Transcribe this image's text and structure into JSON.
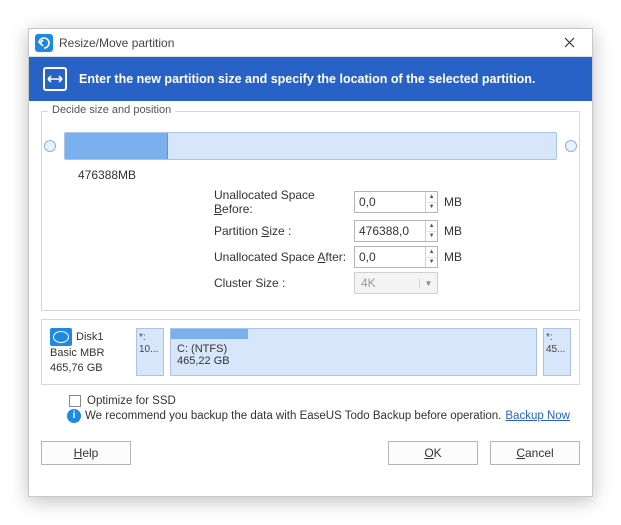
{
  "window": {
    "title": "Resize/Move partition"
  },
  "banner": {
    "text": "Enter the new partition size and specify the location of the selected partition."
  },
  "fieldset": {
    "legend": "Decide size and position",
    "partition_size_text": "476388MB",
    "fill_percent": 21
  },
  "form": {
    "unalloc_before": {
      "label_pre": "Unallocated Space ",
      "accel": "B",
      "label_post": "efore:",
      "value": "0,0",
      "unit": "MB"
    },
    "partition_size": {
      "label_pre": "Partition ",
      "accel": "S",
      "label_post": "ize :",
      "value": "476388,0",
      "unit": "MB"
    },
    "unalloc_after": {
      "label_pre": "Unallocated Space ",
      "accel": "A",
      "label_post": "fter:",
      "value": "0,0",
      "unit": "MB"
    },
    "cluster": {
      "label": "Cluster Size :",
      "value": "4K"
    }
  },
  "disk": {
    "name": "Disk1",
    "type": "Basic MBR",
    "capacity": "465,76 GB",
    "mini_left": {
      "label": "*:",
      "size": "10..."
    },
    "main": {
      "label": "C: (NTFS)",
      "size": "465,22 GB",
      "fill_percent": 21
    },
    "mini_right": {
      "label": "*:",
      "size": "45..."
    }
  },
  "options": {
    "ssd_label": "Optimize for SSD",
    "recommend_text": "We recommend you backup the data with EaseUS Todo Backup before operation.",
    "backup_link": "Backup Now"
  },
  "buttons": {
    "help_accel": "H",
    "help_rest": "elp",
    "ok_accel": "O",
    "ok_rest": "K",
    "cancel_accel": "C",
    "cancel_rest": "ancel"
  }
}
